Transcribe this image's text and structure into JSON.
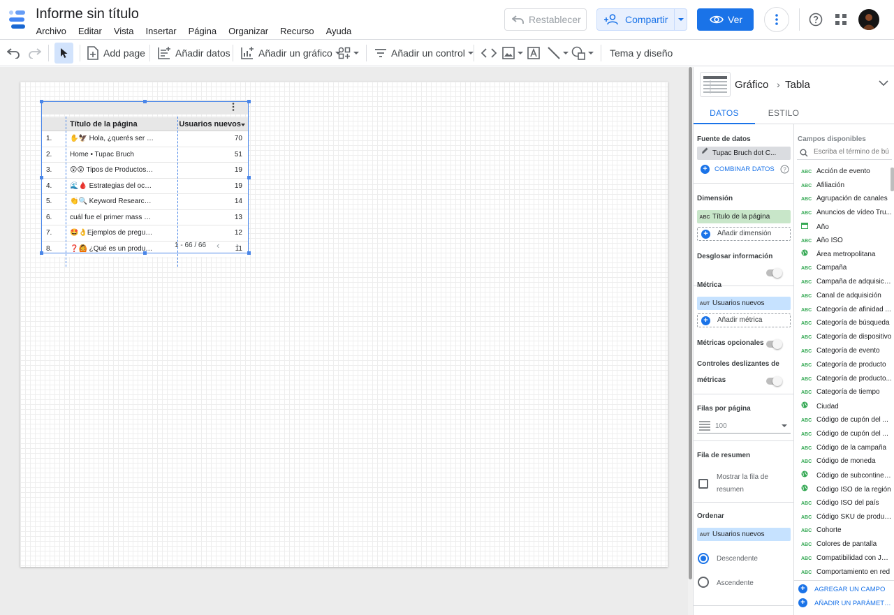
{
  "app": {
    "title": "Informe sin título",
    "menu": [
      "Archivo",
      "Editar",
      "Vista",
      "Insertar",
      "Página",
      "Organizar",
      "Recurso",
      "Ayuda"
    ],
    "reset_label": "Restablecer",
    "share_label": "Compartir",
    "view_label": "Ver",
    "brand_color": "#1a73e8"
  },
  "toolbar": {
    "add_page": "Add page",
    "add_data": "Añadir datos",
    "add_chart": "Añadir un gráfico",
    "add_control": "Añadir un control",
    "theme": "Tema y diseño"
  },
  "table": {
    "col_title": "Título de la página",
    "col_value": "Usuarios nuevos",
    "rows": [
      {
        "n": "1.",
        "title": "✋🦅 Hola, ¿querés ser tu ...",
        "value": "70"
      },
      {
        "n": "2.",
        "title": "Home • Tupac Bruch",
        "value": "51"
      },
      {
        "n": "3.",
        "title": "😲😲 Tipos de Productos:...",
        "value": "19"
      },
      {
        "n": "4.",
        "title": "🌊🩸 Estrategias del océa...",
        "value": "19"
      },
      {
        "n": "5.",
        "title": "👏🔍 Keyword Research T...",
        "value": "14"
      },
      {
        "n": "6.",
        "title": "cuál fue el primer mass me...",
        "value": "13"
      },
      {
        "n": "7.",
        "title": "🤩👌Ejemplos de pregunta...",
        "value": "12"
      },
      {
        "n": "8.",
        "title": "❓🙆 ¿Qué es un producto...",
        "value": "11"
      }
    ],
    "pager": "1 - 66 / 66"
  },
  "panel": {
    "breadcrumb_a": "Gráfico",
    "breadcrumb_b": "Tabla",
    "tab_data": "DATOS",
    "tab_style": "ESTILO",
    "source_title": "Fuente de datos",
    "source_name": "Tupac Bruch dot C...",
    "combine": "COMBINAR DATOS",
    "dimension_title": "Dimensión",
    "dimension_tag": "ABC",
    "dimension_value": "Título de la página",
    "add_dimension": "Añadir dimensión",
    "breakdown_title": "Desglosar información",
    "metric_title": "Métrica",
    "metric_tag": "AUT",
    "metric_value": "Usuarios nuevos",
    "add_metric": "Añadir métrica",
    "optional_metrics": "Métricas opcionales",
    "sliders_line1": "Controles deslizantes de",
    "sliders_line2": "métricas",
    "rows_per_page_title": "Filas por página",
    "rows_per_page": "100",
    "summary_title": "Fila de resumen",
    "summary_line1": "Mostrar la fila de",
    "summary_line2": "resumen",
    "sort_title": "Ordenar",
    "sort_tag": "AUT",
    "sort_value": "Usuarios nuevos",
    "sort_desc": "Descendente",
    "sort_asc": "Ascendente",
    "fields_title": "Campos disponibles",
    "search_placeholder": "Escriba el término de bú",
    "fields": [
      {
        "tag": "ABC",
        "label": "Acción de evento"
      },
      {
        "tag": "ABC",
        "label": "Afiliación"
      },
      {
        "tag": "ABC",
        "label": "Agrupación de canales"
      },
      {
        "tag": "ABC",
        "label": "Anuncios de vídeo Tru..."
      },
      {
        "tag": "cal",
        "label": "Año"
      },
      {
        "tag": "ABC",
        "label": "Año ISO"
      },
      {
        "tag": "geo",
        "label": "Área metropolitana"
      },
      {
        "tag": "ABC",
        "label": "Campaña"
      },
      {
        "tag": "ABC",
        "label": "Campaña de adquisición"
      },
      {
        "tag": "ABC",
        "label": "Canal de adquisición"
      },
      {
        "tag": "ABC",
        "label": "Categoría de afinidad ..."
      },
      {
        "tag": "ABC",
        "label": "Categoría de búsqueda"
      },
      {
        "tag": "ABC",
        "label": "Categoría de dispositivo"
      },
      {
        "tag": "ABC",
        "label": "Categoría de evento"
      },
      {
        "tag": "ABC",
        "label": "Categoría de producto"
      },
      {
        "tag": "ABC",
        "label": "Categoría de producto..."
      },
      {
        "tag": "ABC",
        "label": "Categoría de tiempo"
      },
      {
        "tag": "geo",
        "label": "Ciudad"
      },
      {
        "tag": "ABC",
        "label": "Código de cupón del ..."
      },
      {
        "tag": "ABC",
        "label": "Código de cupón del ..."
      },
      {
        "tag": "ABC",
        "label": "Código de la campaña"
      },
      {
        "tag": "ABC",
        "label": "Código de moneda"
      },
      {
        "tag": "geo",
        "label": "Código de subcontinente"
      },
      {
        "tag": "geo",
        "label": "Código ISO de la región"
      },
      {
        "tag": "ABC",
        "label": "Código ISO del país"
      },
      {
        "tag": "ABC",
        "label": "Código SKU de producto"
      },
      {
        "tag": "ABC",
        "label": "Cohorte"
      },
      {
        "tag": "ABC",
        "label": "Colores de pantalla"
      },
      {
        "tag": "ABC",
        "label": "Compatibilidad con Java"
      },
      {
        "tag": "ABC",
        "label": "Comportamiento en red"
      }
    ],
    "add_field": "AGREGAR UN CAMPO",
    "add_param": "AÑADIR UN PARÁMETRO"
  }
}
